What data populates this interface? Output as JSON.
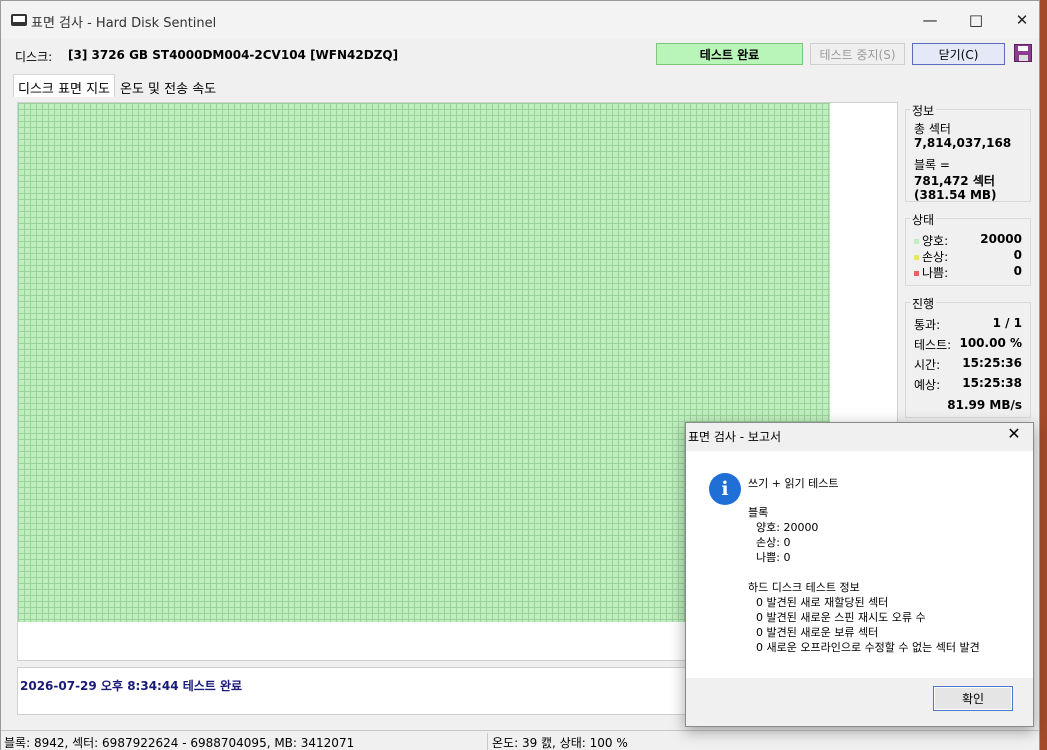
{
  "window": {
    "title": "표면 검사 - Hard Disk Sentinel"
  },
  "toolbar": {
    "disk_label": "디스크:",
    "disk_value": "[3] 3726 GB  ST4000DM004-2CV104 [WFN42DZQ]",
    "status": "테스트 완료",
    "stop_label": "테스트 중지(S)",
    "close_label": "닫기(C)"
  },
  "tabs": [
    {
      "label": "디스크 표면 지도"
    },
    {
      "label": "온도 및 전송 속도"
    }
  ],
  "log": {
    "line": "2026-07-29  오후 8:34:44   테스트 완료"
  },
  "info": {
    "title": "정보",
    "total_sectors_label": "총 섹터",
    "total_sectors_value": "7,814,037,168",
    "block_label": "블록 =",
    "block_sectors": "781,472 섹터",
    "block_size": "(381.54 MB)"
  },
  "status": {
    "title": "상태",
    "rows": [
      {
        "label": "양호:",
        "value": "20000",
        "color": "#bfeebf"
      },
      {
        "label": "손상:",
        "value": "0",
        "color": "#e6e66a"
      },
      {
        "label": "나쁨:",
        "value": "0",
        "color": "#e06666"
      }
    ]
  },
  "progress": {
    "title": "진행",
    "rows": [
      {
        "label": "통과:",
        "value": "1 / 1"
      },
      {
        "label": "테스트:",
        "value": "100.00 %"
      },
      {
        "label": "시간:",
        "value": "15:25:36"
      },
      {
        "label": "예상:",
        "value": "15:25:38"
      }
    ],
    "speed": "81.99 MB/s"
  },
  "statusbar": {
    "left": "블록: 8942, 섹터: 6987922624 - 6988704095, MB: 3412071",
    "right": "온도: 39  캜,  상태: 100 %"
  },
  "dialog": {
    "title": "표면 검사 - 보고서",
    "test_type": "쓰기 + 읽기 테스트",
    "blocks_header": "블록",
    "good": "양호: 20000",
    "damaged": "손상: 0",
    "bad": "나쁨: 0",
    "info_header": "하드 디스크 테스트 정보",
    "lines": [
      "0 발견된 새로 재할당된 섹터",
      "0 발견된 새로운 스핀 재시도 오류 수",
      "0 발견된 새로운 보류 섹터",
      "0 새로운 오프라인으로 수정할 수 없는 섹터 발견"
    ],
    "ok_label": "확인"
  },
  "colors": {
    "surface_good": "#bfeebf",
    "status_done": "#b9f5b9",
    "info_icon": "#1f6fd6"
  }
}
